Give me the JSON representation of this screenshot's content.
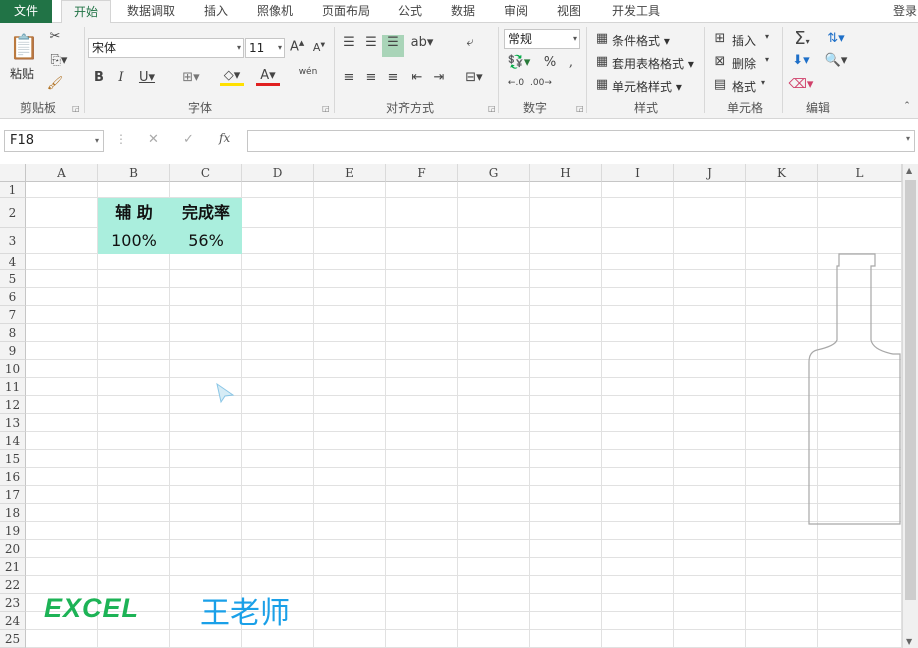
{
  "tabs": [
    "文件",
    "开始",
    "数据调取",
    "插入",
    "照像机",
    "页面布局",
    "公式",
    "数据",
    "审阅",
    "视图",
    "开发工具"
  ],
  "login": "登录",
  "ribbon": {
    "clipboard": {
      "paste": "粘贴",
      "label": "剪贴板"
    },
    "font": {
      "name": "宋体",
      "size": "11",
      "label": "字体",
      "phonetic": "wén"
    },
    "align": {
      "label": "对齐方式"
    },
    "number": {
      "format": "常规",
      "label": "数字"
    },
    "styles": {
      "cond": "条件格式 ▾",
      "table": "套用表格格式 ▾",
      "cell": "单元格样式 ▾",
      "label": "样式"
    },
    "cells": {
      "insert": "插入",
      "delete": "删除",
      "format": "格式",
      "label": "单元格"
    },
    "editing": {
      "label": "编辑"
    }
  },
  "formula_bar": {
    "name_box": "F18",
    "formula": ""
  },
  "columns": [
    "A",
    "B",
    "C",
    "D",
    "E",
    "F",
    "G",
    "H",
    "I",
    "J",
    "K",
    "L"
  ],
  "rows": [
    "1",
    "2",
    "3",
    "4",
    "5",
    "6",
    "7",
    "8",
    "9",
    "10",
    "11",
    "12",
    "13",
    "14",
    "15",
    "16",
    "17",
    "18",
    "19",
    "20",
    "21",
    "22",
    "23",
    "24",
    "25"
  ],
  "table": {
    "h1": "辅  助",
    "h2": "完成率",
    "v1": "100%",
    "v2": "56%"
  },
  "watermark": {
    "excel": "EXCEL",
    "name": "王老师"
  },
  "colors": {
    "accent": "#217346",
    "highlight": "#aaeedd",
    "wm_green": "#1db356",
    "wm_blue": "#1aa0e8"
  }
}
